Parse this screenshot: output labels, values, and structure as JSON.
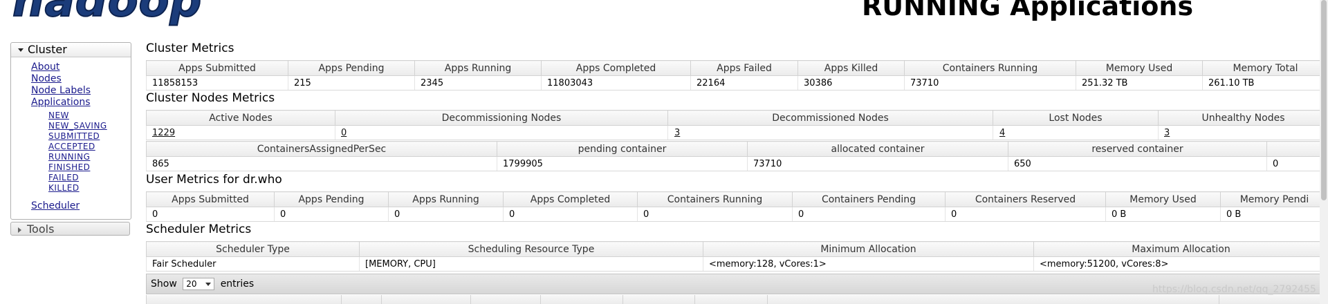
{
  "header": {
    "logo_text": "hadoop",
    "page_title": "RUNNING Applications"
  },
  "sidebar": {
    "cluster_label": "Cluster",
    "links": [
      "About",
      "Nodes",
      "Node Labels",
      "Applications"
    ],
    "app_states": [
      "NEW",
      "NEW_SAVING",
      "SUBMITTED",
      "ACCEPTED",
      "RUNNING",
      "FINISHED",
      "FAILED",
      "KILLED"
    ],
    "scheduler_label": "Scheduler",
    "tools_label": "Tools"
  },
  "cluster_metrics": {
    "title": "Cluster Metrics",
    "headers": [
      "Apps Submitted",
      "Apps Pending",
      "Apps Running",
      "Apps Completed",
      "Apps Failed",
      "Apps Killed",
      "Containers Running",
      "Memory Used",
      "Memory Total"
    ],
    "values": [
      "11858153",
      "215",
      "2345",
      "11803043",
      "22164",
      "30386",
      "73710",
      "251.32 TB",
      "261.10 TB"
    ]
  },
  "cluster_nodes_metrics": {
    "title": "Cluster Nodes Metrics",
    "headers": [
      "Active Nodes",
      "Decommissioning Nodes",
      "Decommissioned Nodes",
      "Lost Nodes",
      "Unhealthy Nodes"
    ],
    "values": [
      "1229",
      "0",
      "3",
      "4",
      "3"
    ],
    "headers2": [
      "ContainersAssignedPerSec",
      "pending container",
      "allocated container",
      "reserved container",
      ""
    ],
    "values2": [
      "865",
      "1799905",
      "73710",
      "650",
      "0"
    ]
  },
  "user_metrics": {
    "title": "User Metrics for dr.who",
    "headers": [
      "Apps Submitted",
      "Apps Pending",
      "Apps Running",
      "Apps Completed",
      "Containers Running",
      "Containers Pending",
      "Containers Reserved",
      "Memory Used",
      "Memory Pendi"
    ],
    "values": [
      "0",
      "0",
      "0",
      "0",
      "0",
      "0",
      "0",
      "0 B",
      "0 B"
    ]
  },
  "scheduler_metrics": {
    "title": "Scheduler Metrics",
    "headers": [
      "Scheduler Type",
      "Scheduling Resource Type",
      "Minimum Allocation",
      "Maximum Allocation"
    ],
    "values": [
      "Fair Scheduler",
      "[MEMORY, CPU]",
      "<memory:128, vCores:1>",
      "<memory:51200, vCores:8>"
    ]
  },
  "table_controls": {
    "show_label": "Show",
    "entries_value": "20",
    "entries_label": "entries"
  },
  "watermark": "https://blog.csdn.net/qq_2792455"
}
